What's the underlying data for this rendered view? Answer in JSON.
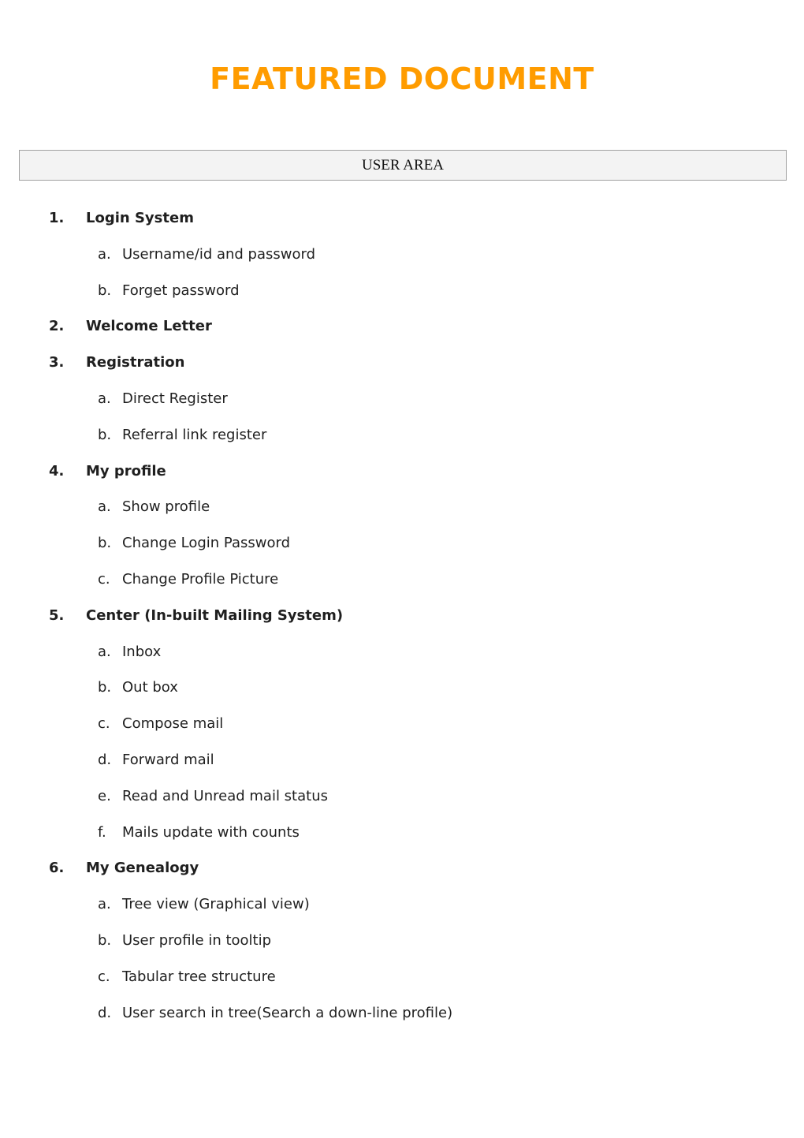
{
  "title": "FEATURED DOCUMENT",
  "section_header": "USER AREA",
  "colors": {
    "title": "#ff9c00",
    "section_bg": "#f3f3f3",
    "section_border": "#a0a0a0"
  },
  "items": [
    {
      "num": "1.",
      "label": "Login System",
      "subs": [
        {
          "letter": "a.",
          "label": "Username/id and password"
        },
        {
          "letter": "b.",
          "label": "Forget password"
        }
      ]
    },
    {
      "num": "2.",
      "label": "Welcome Letter",
      "subs": []
    },
    {
      "num": "3.",
      "label": "Registration",
      "subs": [
        {
          "letter": "a.",
          "label": "Direct Register"
        },
        {
          "letter": "b.",
          "label": "Referral link register"
        }
      ]
    },
    {
      "num": "4.",
      "label": "My profile",
      "subs": [
        {
          "letter": "a.",
          "label": "Show profile"
        },
        {
          "letter": "b.",
          "label": "Change Login Password"
        },
        {
          "letter": "c.",
          "label": "Change Profile Picture"
        }
      ]
    },
    {
      "num": "5.",
      "label": "Center (In-built Mailing System)",
      "subs": [
        {
          "letter": "a.",
          "label": "Inbox"
        },
        {
          "letter": "b.",
          "label": "Out box"
        },
        {
          "letter": "c.",
          "label": "Compose mail"
        },
        {
          "letter": "d.",
          "label": "Forward mail"
        },
        {
          "letter": "e.",
          "label": "Read and Unread mail status"
        },
        {
          "letter": "f.",
          "label": "Mails update with counts"
        }
      ]
    },
    {
      "num": "6.",
      "label": "My Genealogy",
      "subs": [
        {
          "letter": "a.",
          "label": "Tree view (Graphical view)"
        },
        {
          "letter": "b.",
          "label": "User profile in tooltip"
        },
        {
          "letter": "c.",
          "label": "Tabular tree structure"
        },
        {
          "letter": "d.",
          "label": "User search in tree(Search a down-line profile)"
        }
      ]
    }
  ]
}
